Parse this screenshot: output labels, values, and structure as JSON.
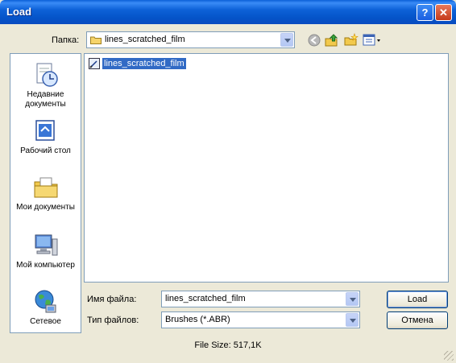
{
  "window": {
    "title": "Load"
  },
  "toolbar": {
    "folder_label": "Папка:",
    "folder_value": "lines_scratched_film"
  },
  "places": [
    {
      "label": "Недавние документы"
    },
    {
      "label": "Рабочий стол"
    },
    {
      "label": "Мои документы"
    },
    {
      "label": "Мой компьютер"
    },
    {
      "label": "Сетевое"
    }
  ],
  "files": [
    {
      "name": "lines_scratched_film"
    }
  ],
  "form": {
    "filename_label": "Имя файла:",
    "filename_value": "lines_scratched_film",
    "filetype_label": "Тип файлов:",
    "filetype_value": "Brushes (*.ABR)"
  },
  "buttons": {
    "load": "Load",
    "cancel": "Отмена"
  },
  "status": {
    "file_size": "File Size: 517,1K"
  }
}
